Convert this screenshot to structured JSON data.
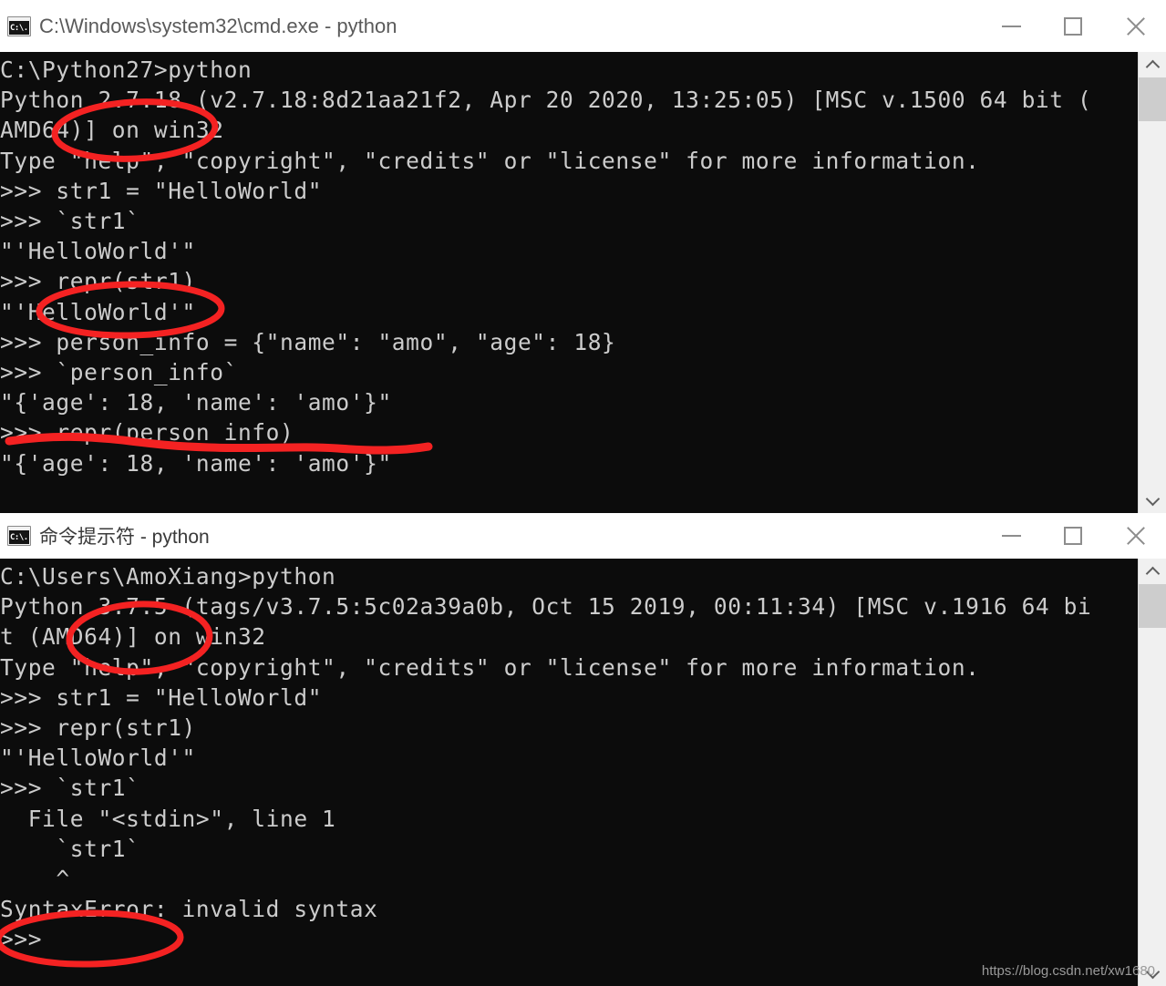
{
  "windows": [
    {
      "id": "cmd-python27",
      "title": "C:\\Windows\\system32\\cmd.exe - python",
      "icon": "console-icon",
      "controls": {
        "minimize": "minimize-button",
        "maximize": "maximize-button",
        "close": "close-button"
      },
      "console": "C:\\Python27>python\nPython 2.7.18 (v2.7.18:8d21aa21f2, Apr 20 2020, 13:25:05) [MSC v.1500 64 bit (\nAMD64)] on win32\nType \"help\", \"copyright\", \"credits\" or \"license\" for more information.\n>>> str1 = \"HelloWorld\"\n>>> `str1`\n\"'HelloWorld'\"\n>>> repr(str1)\n\"'HelloWorld'\"\n>>> person_info = {\"name\": \"amo\", \"age\": 18}\n>>> `person_info`\n\"{'age': 18, 'name': 'amo'}\"\n>>> repr(person_info)\n\"{'age': 18, 'name': 'amo'}\""
    },
    {
      "id": "cmd-python375",
      "title": "命令提示符 - python",
      "icon": "console-icon",
      "controls": {
        "minimize": "minimize-button",
        "maximize": "maximize-button",
        "close": "close-button"
      },
      "console": "C:\\Users\\AmoXiang>python\nPython 3.7.5 (tags/v3.7.5:5c02a39a0b, Oct 15 2019, 00:11:34) [MSC v.1916 64 bi\nt (AMD64)] on win32\nType \"help\", \"copyright\", \"credits\" or \"license\" for more information.\n>>> str1 = \"HelloWorld\"\n>>> repr(str1)\n\"'HelloWorld'\"\n>>> `str1`\n  File \"<stdin>\", line 1\n    `str1`\n    ^\nSyntaxError: invalid syntax\n>>>"
    }
  ],
  "annotations": {
    "color": "#f42222",
    "items": [
      {
        "name": "ellipse-python-2-7-18",
        "type": "ellipse",
        "target": "2.7.18"
      },
      {
        "name": "ellipse-repr-str1",
        "type": "ellipse",
        "target": "repr(str1)"
      },
      {
        "name": "underline-dict-repr",
        "type": "underline",
        "target": "\"{'age': 18, 'name': 'amo'}\""
      },
      {
        "name": "ellipse-python-3-7-5",
        "type": "ellipse",
        "target": "3.7.5"
      },
      {
        "name": "ellipse-syntaxerror",
        "type": "ellipse",
        "target": "SyntaxError:"
      }
    ]
  },
  "scrollbars": {
    "up_arrow": "scroll-up-arrow",
    "down_arrow": "scroll-down-arrow",
    "thumb": "scroll-thumb"
  },
  "watermark": "https://blog.csdn.net/xw1680"
}
